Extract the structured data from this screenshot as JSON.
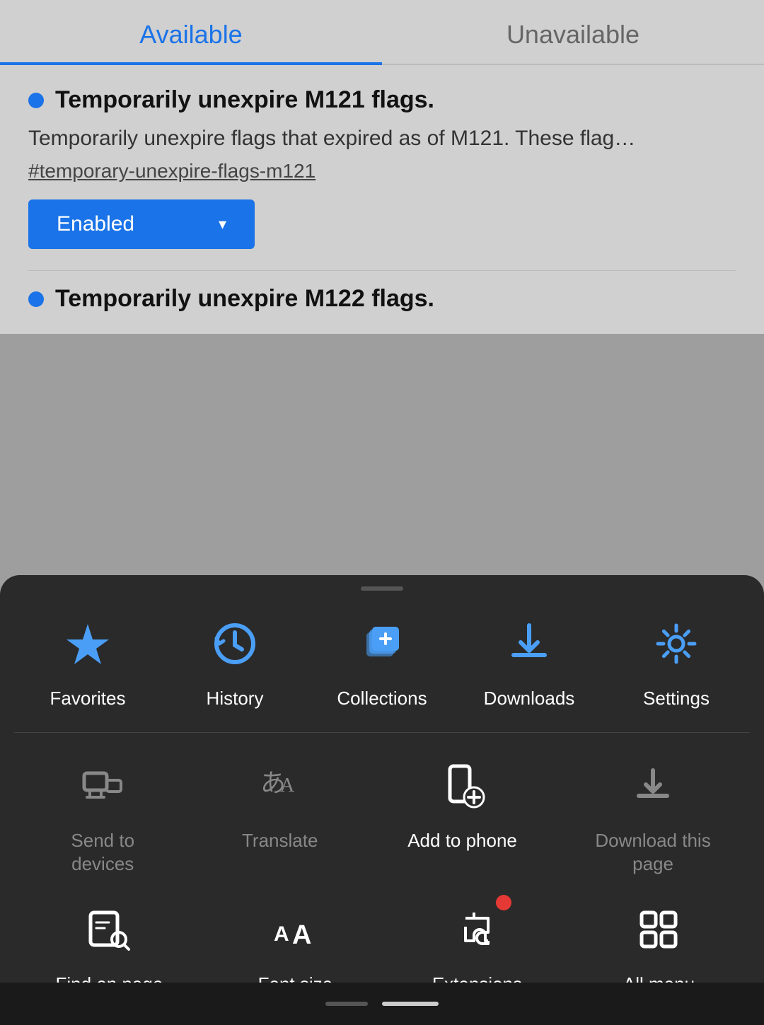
{
  "tabs": {
    "available": "Available",
    "unavailable": "Unavailable"
  },
  "flag1": {
    "title": "Temporarily unexpire M121 flags.",
    "description": "Temporarily unexpire flags that expired as of M121. These flag…",
    "link": "#temporary-unexpire-flags-m121",
    "button": "Enabled"
  },
  "flag2": {
    "title": "Temporarily unexpire M122 flags."
  },
  "bottomSheet": {
    "row1": [
      {
        "label": "Favorites",
        "icon": "star-icon",
        "color": "#4a9ef5"
      },
      {
        "label": "History",
        "icon": "history-icon",
        "color": "#4a9ef5"
      },
      {
        "label": "Collections",
        "icon": "collections-icon",
        "color": "#4a9ef5"
      },
      {
        "label": "Downloads",
        "icon": "downloads-icon",
        "color": "#4a9ef5"
      },
      {
        "label": "Settings",
        "icon": "settings-icon",
        "color": "#4a9ef5"
      }
    ],
    "row2": [
      {
        "label": "Send to\ndevices",
        "icon": "send-devices-icon",
        "disabled": true
      },
      {
        "label": "Translate",
        "icon": "translate-icon",
        "disabled": true
      },
      {
        "label": "Add to phone",
        "icon": "add-phone-icon",
        "disabled": false
      },
      {
        "label": "Download this\npage",
        "icon": "download-page-icon",
        "disabled": true
      }
    ],
    "row3": [
      {
        "label": "Find on page",
        "icon": "find-icon",
        "disabled": false
      },
      {
        "label": "Font size",
        "icon": "font-size-icon",
        "disabled": false
      },
      {
        "label": "Extensions",
        "icon": "extensions-icon",
        "disabled": false,
        "badge": true
      },
      {
        "label": "All menu",
        "icon": "all-menu-icon",
        "disabled": false
      }
    ]
  },
  "colors": {
    "accent": "#1a73e8",
    "iconBlue": "#4a9ef5",
    "iconGray": "#888888",
    "iconWhite": "#ffffff",
    "badgeRed": "#e53935",
    "sheetBg": "#2a2a2a"
  }
}
